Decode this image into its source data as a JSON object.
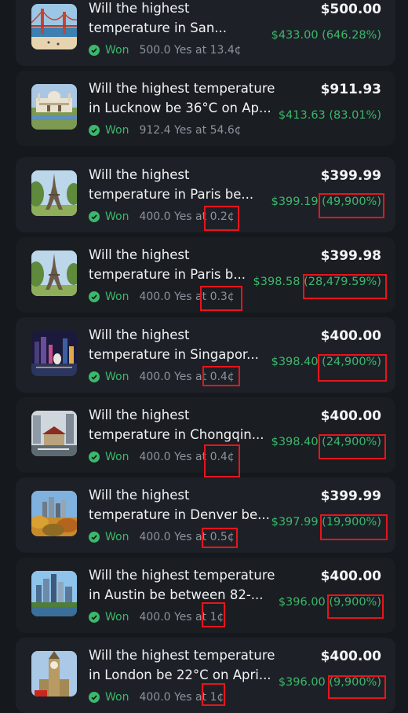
{
  "positions": [
    {
      "title_line1": "Will the highest",
      "title_line2": "temperature in San...",
      "status": "Won",
      "shares": "500.0 Yes at 13.4¢",
      "value": "$500.00",
      "pnl": "$433.00 (646.28%)",
      "image": "golden-gate-bridge-thumbnail"
    },
    {
      "title_line1": "Will the highest temperature",
      "title_line2": "in Lucknow be 36°C on Ap...",
      "status": "Won",
      "shares": "912.4 Yes at 54.6¢",
      "value": "$911.93",
      "pnl": "$413.63 (83.01%)",
      "image": "lucknow-palace-thumbnail"
    },
    {
      "title_line1": "Will the highest",
      "title_line2": "temperature in Paris be...",
      "status": "Won",
      "shares": "400.0 Yes at 0.2¢",
      "value": "$399.99",
      "pnl": "$399.19 (49,900%)",
      "image": "eiffel-tower-thumbnail"
    },
    {
      "title_line1": "Will the highest",
      "title_line2": "temperature in Paris b...",
      "status": "Won",
      "shares": "400.0 Yes at 0.3¢",
      "value": "$399.98",
      "pnl": "$398.58 (28,479.59%)",
      "image": "eiffel-tower-thumbnail"
    },
    {
      "title_line1": "Will the highest",
      "title_line2": "temperature in Singapor...",
      "status": "Won",
      "shares": "400.0 Yes at 0.4¢",
      "value": "$400.00",
      "pnl": "$398.40 (24,900%)",
      "image": "singapore-skyline-thumbnail"
    },
    {
      "title_line1": "Will the highest",
      "title_line2": "temperature in Chongqin...",
      "status": "Won",
      "shares": "400.0 Yes at 0.4¢",
      "value": "$400.00",
      "pnl": "$398.40 (24,900%)",
      "image": "chongqing-thumbnail"
    },
    {
      "title_line1": "Will the highest",
      "title_line2": "temperature in Denver be...",
      "status": "Won",
      "shares": "400.0 Yes at 0.5¢",
      "value": "$399.99",
      "pnl": "$397.99 (19,900%)",
      "image": "denver-thumbnail"
    },
    {
      "title_line1": "Will the highest temperature",
      "title_line2": "in Austin be between 82-...",
      "status": "Won",
      "shares": "400.0 Yes at 1¢",
      "value": "$400.00",
      "pnl": "$396.00 (9,900%)",
      "image": "austin-skyline-thumbnail"
    },
    {
      "title_line1": "Will the highest temperature",
      "title_line2": "in London be 22°C on Apri...",
      "status": "Won",
      "shares": "400.0 Yes at 1¢",
      "value": "$400.00",
      "pnl": "$396.00 (9,900%)",
      "image": "big-ben-thumbnail"
    }
  ],
  "colors": {
    "background": "#15181d",
    "card": "#1d2127",
    "won": "#3bb86b",
    "highlight_box": "#e8141c"
  }
}
